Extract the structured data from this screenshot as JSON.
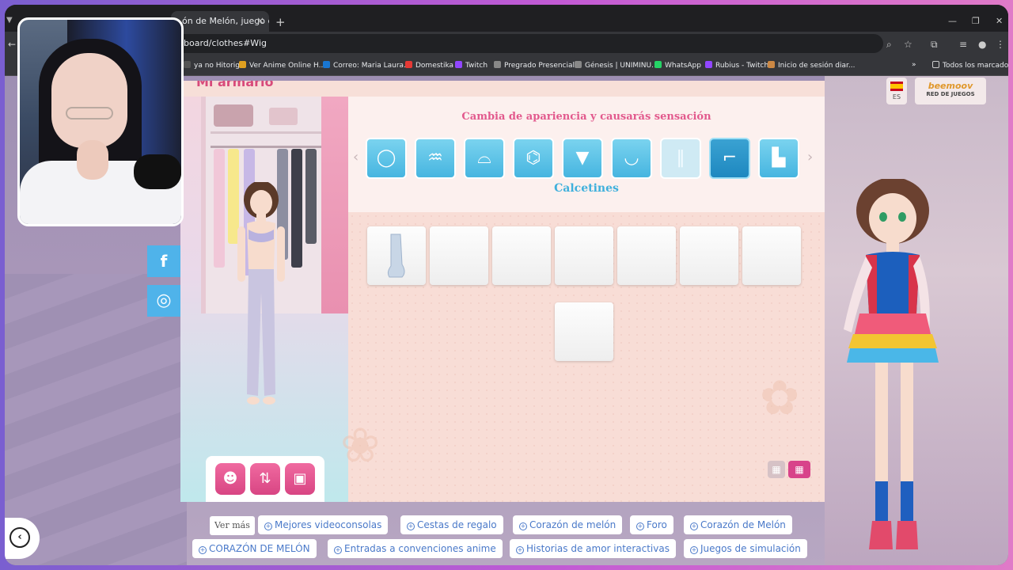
{
  "browser": {
    "tab_title": "ón de Melón, juego de an",
    "tab_close": "×",
    "new_tab": "+",
    "url": "board/clothes#Wig",
    "bookmarks": [
      {
        "label": "ya no Hitorig...",
        "color": "#555555"
      },
      {
        "label": "Ver Anime Online H...",
        "color": "#e0a020"
      },
      {
        "label": "Correo: Maria Laura...",
        "color": "#1976d2"
      },
      {
        "label": "Domestika",
        "color": "#e53935"
      },
      {
        "label": "Twitch",
        "color": "#9146ff"
      },
      {
        "label": "Pregrado Presencial...",
        "color": "#888888"
      },
      {
        "label": "Génesis | UNIMINU...",
        "color": "#888888"
      },
      {
        "label": "WhatsApp",
        "color": "#25d366"
      },
      {
        "label": "Rubius - Twitch",
        "color": "#9146ff"
      },
      {
        "label": "Inicio de sesión diar...",
        "color": "#cc8844"
      }
    ],
    "all_bookmarks": "Todos los marcadores"
  },
  "social": {
    "facebook": "f",
    "instagram": "◎"
  },
  "game": {
    "title": "Mi armario",
    "tagline": "Cambia de apariencia y causarás sensación",
    "categories": [
      {
        "name": "accesorios",
        "glyph": "◯",
        "state": "normal"
      },
      {
        "name": "pelucas",
        "glyph": "♒",
        "state": "normal"
      },
      {
        "name": "sombreros",
        "glyph": "⌓",
        "state": "normal"
      },
      {
        "name": "chaquetas",
        "glyph": "⌬",
        "state": "normal"
      },
      {
        "name": "camisetas",
        "glyph": "▼",
        "state": "normal"
      },
      {
        "name": "ropa-interior",
        "glyph": "◡",
        "state": "normal"
      },
      {
        "name": "pantalones",
        "glyph": "‖",
        "state": "faded"
      },
      {
        "name": "calcetines",
        "glyph": "⌐",
        "state": "active"
      },
      {
        "name": "zapatos",
        "glyph": "▙",
        "state": "normal"
      }
    ],
    "selected_category": "Calcetines",
    "lang": "ES",
    "logo_top": "beemoov",
    "logo_bottom": "RED DE JUEGOS"
  },
  "footer": {
    "ver_mas": "Ver más",
    "row1": [
      "Mejores videoconsolas",
      "Cestas de regalo",
      "Corazón de melón",
      "Foro",
      "Corazón de Melón"
    ],
    "row2": [
      "CORAZÓN DE MELÓN",
      "Entradas a convenciones anime",
      "Historias de amor interactivas",
      "Juegos de simulación"
    ]
  },
  "colors": {
    "accent_pink": "#e2598d",
    "accent_blue": "#3fb0dc"
  }
}
